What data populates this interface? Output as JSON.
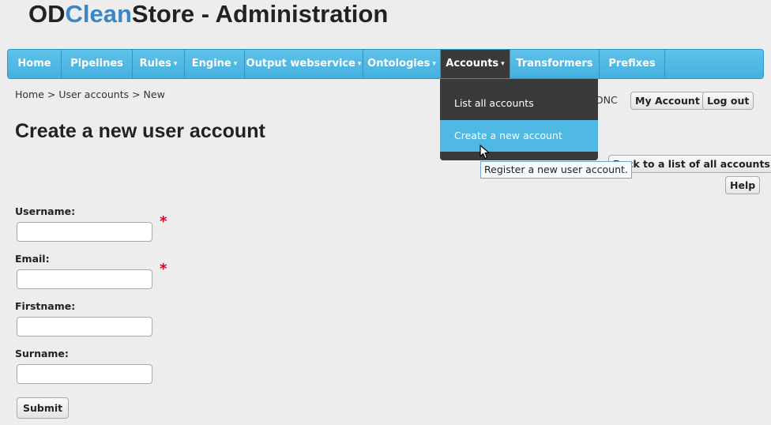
{
  "app": {
    "title_od": "OD",
    "title_clean": "Clean",
    "title_rest": "Store - Administration"
  },
  "nav": {
    "home": "Home",
    "pipelines": "Pipelines",
    "rules": "Rules",
    "engine": "Engine",
    "output_webservice": "Output webservice",
    "ontologies": "Ontologies",
    "accounts": "Accounts",
    "transformers": "Transformers",
    "prefixes": "Prefixes",
    "caret": "▾"
  },
  "dropdown": {
    "list_all": "List all accounts",
    "create_new": "Create a new account"
  },
  "tooltip": "Register a new user account.",
  "breadcrumb": "Home > User accounts > New",
  "user": {
    "name_partial": "DNC",
    "my_account": "My Account",
    "log_out": "Log out"
  },
  "page": {
    "title": "Create a new user account",
    "back_button": "Back to a list of all accounts",
    "help_button": "Help"
  },
  "form": {
    "username_label": "Username:",
    "email_label": "Email:",
    "firstname_label": "Firstname:",
    "surname_label": "Surname:",
    "username_value": "",
    "email_value": "",
    "firstname_value": "",
    "surname_value": "",
    "required_mark": "*",
    "submit_label": "Submit"
  },
  "colors": {
    "nav_blue": "#4fb8e3",
    "nav_dark": "#3a3a3a",
    "brand_blue": "#3d86c6",
    "required_red": "#d0021b"
  }
}
